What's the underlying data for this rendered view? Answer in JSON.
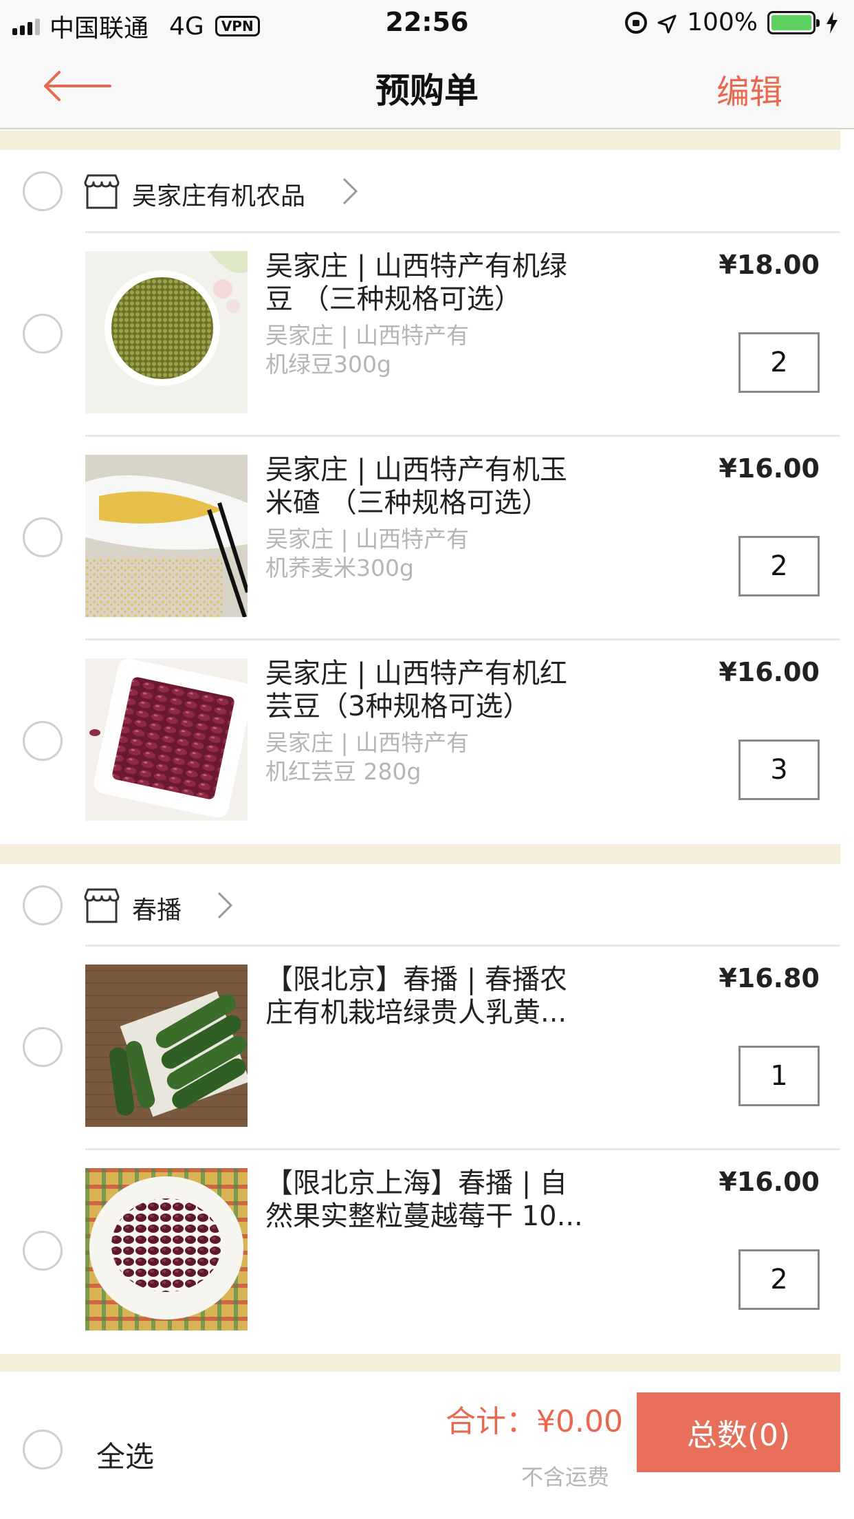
{
  "status_bar": {
    "carrier": "中国联通",
    "network": "4G",
    "vpn": "VPN",
    "time": "22:56",
    "battery": "100%"
  },
  "nav": {
    "title": "预购单",
    "edit_label": "编辑"
  },
  "shops": [
    {
      "name": "吴家庄有机农品",
      "items": [
        {
          "title": "吴家庄 | 山西特产有机绿豆 （三种规格可选）",
          "subtitle": "吴家庄 | 山西特产有机绿豆300g",
          "price": "¥18.00",
          "quantity": "2"
        },
        {
          "title": "吴家庄 | 山西特产有机玉米碴 （三种规格可选）",
          "subtitle": "吴家庄 | 山西特产有机荞麦米300g",
          "price": "¥16.00",
          "quantity": "2"
        },
        {
          "title": "吴家庄 | 山西特产有机红芸豆（3种规格可选）",
          "subtitle": "吴家庄 | 山西特产有机红芸豆 280g",
          "price": "¥16.00",
          "quantity": "3"
        }
      ]
    },
    {
      "name": "春播",
      "items": [
        {
          "title": "【限北京】春播 | 春播农庄有机栽培绿贵人乳黄...",
          "subtitle": "",
          "price": "¥16.80",
          "quantity": "1"
        },
        {
          "title": "【限北京上海】春播 | 自然果实整粒蔓越莓干 10...",
          "subtitle": "",
          "price": "¥16.00",
          "quantity": "2"
        }
      ]
    }
  ],
  "footer": {
    "select_all": "全选",
    "total": "合计：¥0.00",
    "shipping_note": "不含运费",
    "checkout_label": "总数(0)"
  },
  "colors": {
    "accent": "#e8694f",
    "checkout_bg": "#e8705a",
    "band": "#f4efdc",
    "battery": "#5ed161"
  }
}
